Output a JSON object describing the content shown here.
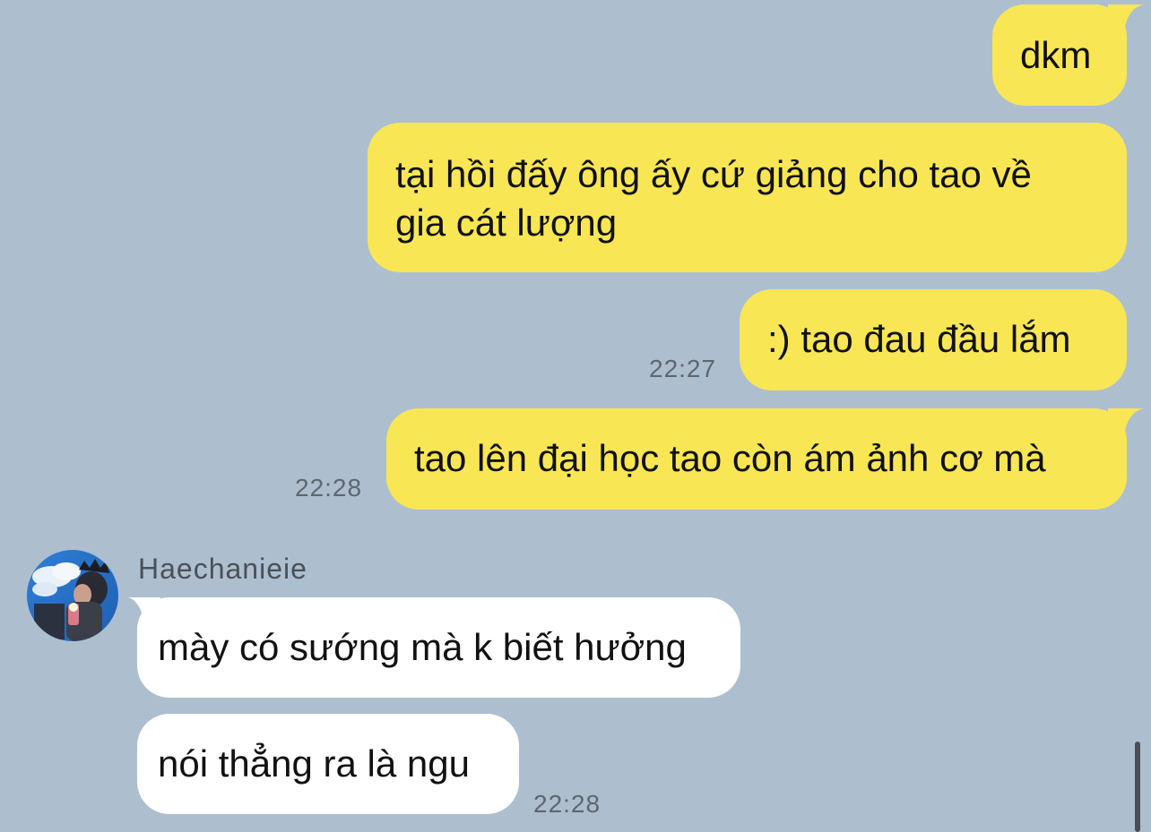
{
  "colors": {
    "background": "#adbfcf",
    "outgoing_bubble": "#f8e655",
    "incoming_bubble": "#ffffff"
  },
  "messages_out": [
    {
      "text": "dkm"
    },
    {
      "text_line1": "tại hồi đấy ông ấy cứ giảng cho tao về",
      "text_line2": "gia cát lượng"
    },
    {
      "text": ":) tao đau đầu lắm",
      "time": "22:27"
    },
    {
      "text": "tao lên đại học tao còn ám ảnh cơ mà",
      "time": "22:28"
    }
  ],
  "incoming": {
    "sender_name": "Haechanieie",
    "avatar_icon": "profile-photo-icon",
    "messages": [
      {
        "text": "mày có sướng mà k biết hưởng"
      },
      {
        "text": "nói thẳng ra là ngu",
        "time": "22:28"
      }
    ]
  }
}
